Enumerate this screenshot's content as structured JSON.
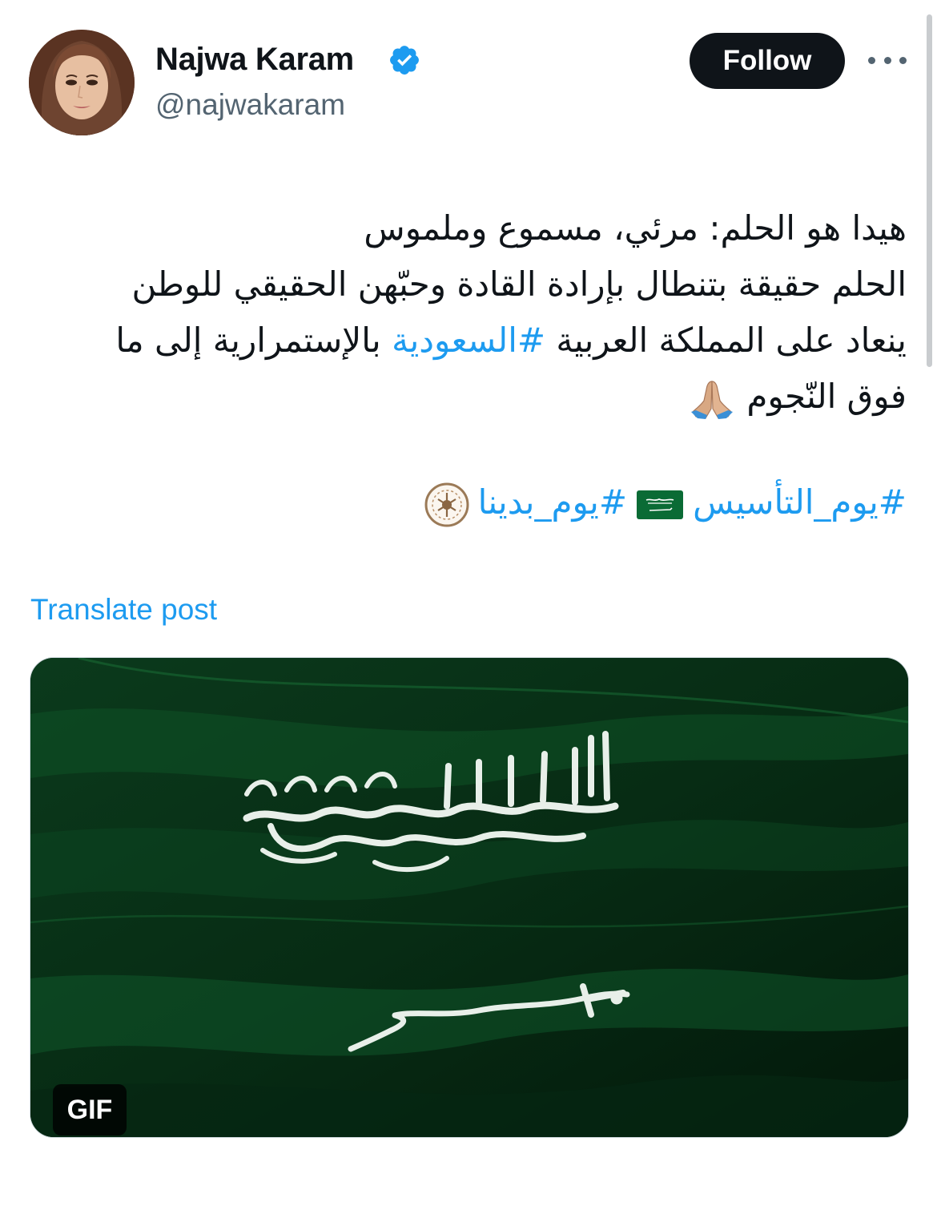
{
  "author": {
    "display_name": "Najwa Karam",
    "handle": "@najwakaram",
    "verified": true
  },
  "actions": {
    "follow_label": "Follow"
  },
  "post": {
    "lines": [
      "هيدا هو الحلم: مرئي، مسموع وملموس",
      "الحلم حقيقة بتنطال بإرادة القادة وحبّهن الحقيقي للوطن",
      "ينعاد على المملكة العربية",
      "#السعودية",
      "بالإستمرارية إلى ما",
      "فوق النّجوم"
    ],
    "hashtags": [
      "#يوم_التأسيس",
      "#يوم_بدينا"
    ],
    "translate_label": "Translate post"
  },
  "media": {
    "badge": "GIF"
  },
  "colors": {
    "accent": "#1d9bf0",
    "follow_bg": "#0f1419",
    "secondary_text": "#536471",
    "flag_green": "#0a5b2a"
  },
  "icons": {
    "verified": "verified-badge-icon",
    "more": "more-options-icon",
    "hands": "folded-hands-emoji",
    "flag": "saudi-flag-emoji",
    "emblem": "founding-day-emblem-emoji"
  }
}
